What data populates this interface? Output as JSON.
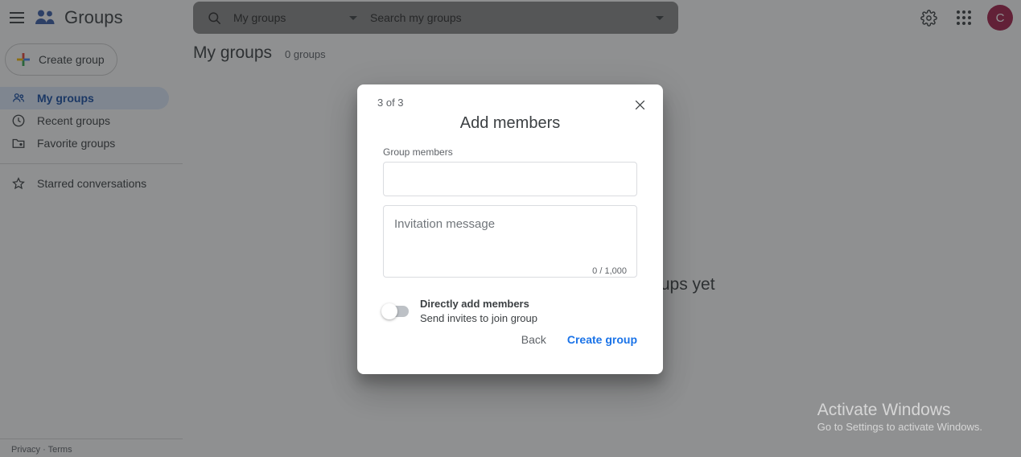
{
  "topbar": {
    "menu_icon": "hamburger-menu-icon",
    "brand_icon": "groups-people-icon",
    "brand_title": "Groups",
    "search_icon": "search-icon",
    "scope_value": "My groups",
    "scope_caret_icon": "chevron-down-icon",
    "search_placeholder": "Search my groups",
    "search_value": "",
    "options_caret_icon": "chevron-down-icon",
    "settings_icon": "gear-icon",
    "apps_icon": "apps-grid-icon",
    "avatar_initial": "C",
    "avatar_color": "#a5214b"
  },
  "sidebar": {
    "create_label": "Create group",
    "create_icon": "google-plus-icon",
    "items": [
      {
        "label": "My groups",
        "icon": "people-icon",
        "active": true
      },
      {
        "label": "Recent groups",
        "icon": "clock-icon",
        "active": false
      },
      {
        "label": "Favorite groups",
        "icon": "folder-star-icon",
        "active": false
      }
    ],
    "items2": [
      {
        "label": "Starred conversations",
        "icon": "star-icon",
        "active": false
      }
    ],
    "active_color": "#174ea6"
  },
  "main": {
    "page_title": "My groups",
    "page_count": "0 groups",
    "empty_text": "You don't have any groups yet"
  },
  "footer": {
    "privacy": "Privacy",
    "separator": "·",
    "terms": "Terms"
  },
  "dialog": {
    "step": "3 of 3",
    "close_icon": "close-icon",
    "title": "Add members",
    "members_label": "Group members",
    "members_value": "",
    "members_placeholder": "",
    "message_placeholder": "Invitation message",
    "message_value": "",
    "char_count": "0 / 1,000",
    "toggle_title": "Directly add members",
    "toggle_sub": "Send invites to join group",
    "toggle_on": false,
    "back_label": "Back",
    "create_label": "Create group",
    "create_color": "#1a73e8"
  },
  "watermark": {
    "title": "Activate Windows",
    "subtitle": "Go to Settings to activate Windows."
  }
}
